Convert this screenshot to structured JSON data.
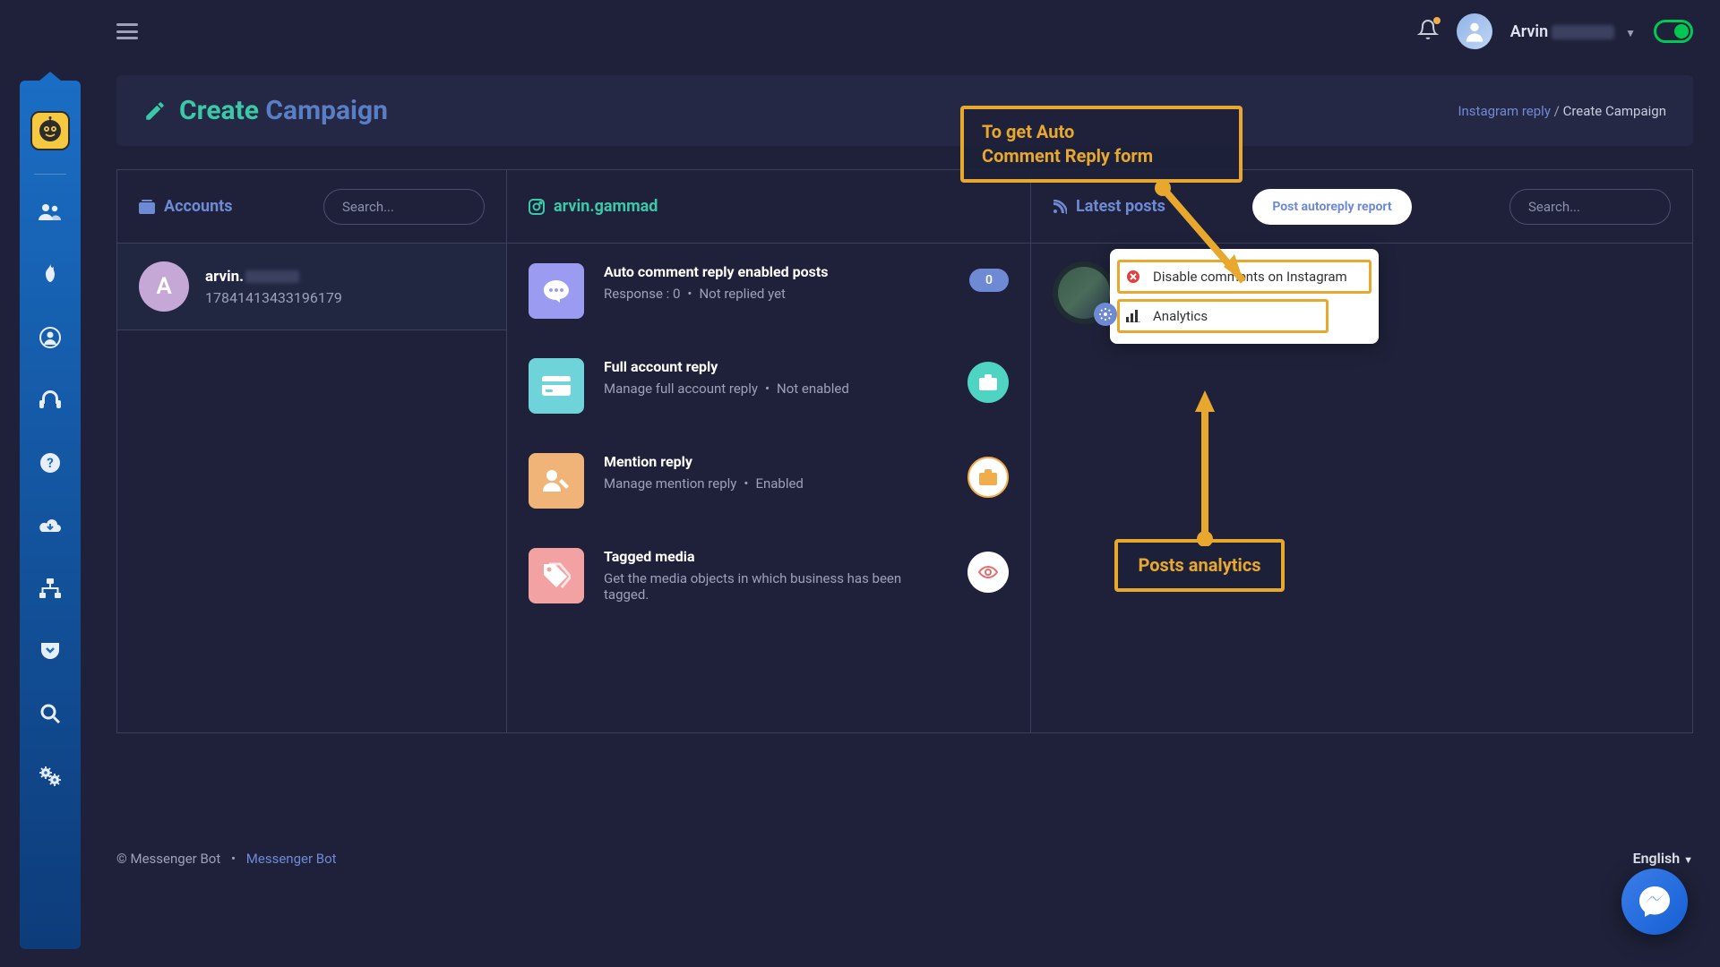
{
  "header": {
    "user_name": "Arvin"
  },
  "page": {
    "title_word1": "Create",
    "title_word2": "Campaign",
    "breadcrumb_link": "Instagram reply",
    "breadcrumb_sep": "/",
    "breadcrumb_current": "Create Campaign"
  },
  "panel_a": {
    "title": "Accounts",
    "search_placeholder": "Search...",
    "account_name": "arvin.",
    "account_avatar_letter": "A",
    "account_id": "17841413433196179"
  },
  "panel_b": {
    "title": "arvin.gammad",
    "features": [
      {
        "title": "Auto comment reply enabled posts",
        "sub_a": "Response : 0",
        "sub_b": "Not replied yet",
        "badge": "0"
      },
      {
        "title": "Full account reply",
        "sub_a": "Manage full account reply",
        "sub_b": "Not enabled"
      },
      {
        "title": "Mention reply",
        "sub_a": "Manage mention reply",
        "sub_b": "Enabled"
      },
      {
        "title": "Tagged media",
        "sub_full": "Get the media objects in which business has been tagged."
      }
    ]
  },
  "panel_c": {
    "title": "Latest posts",
    "report_button": "Post autoreply report",
    "search_placeholder": "Search...",
    "dropdown": {
      "disable": "Disable comments on Instagram",
      "analytics": "Analytics"
    }
  },
  "annotations": {
    "a1_line1": "To get Auto",
    "a1_line2": "Comment Reply form",
    "a2": "Posts analytics"
  },
  "footer": {
    "copyright_prefix": "© Messenger Bot",
    "sep": "•",
    "link": "Messenger Bot",
    "language": "English"
  }
}
